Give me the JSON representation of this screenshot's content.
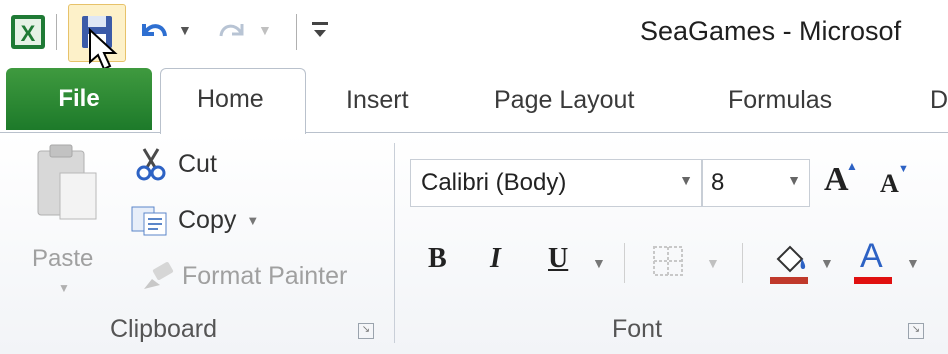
{
  "window": {
    "title": "SeaGames - Microsof"
  },
  "qat": {
    "app_icon": "excel-icon",
    "save_icon": "save-icon",
    "undo_icon": "undo-icon",
    "redo_icon": "redo-icon",
    "customize_icon": "customize-qat-icon"
  },
  "tabs": {
    "file": "File",
    "home": "Home",
    "insert": "Insert",
    "page_layout": "Page Layout",
    "formulas": "Formulas",
    "data": "D"
  },
  "clipboard": {
    "paste": "Paste",
    "cut": "Cut",
    "copy": "Copy",
    "format_painter": "Format Painter",
    "label": "Clipboard"
  },
  "font": {
    "font_name": "Calibri (Body)",
    "font_size": "8",
    "bold": "B",
    "italic": "I",
    "underline": "U",
    "grow": "A",
    "shrink": "A",
    "font_color": "A",
    "label": "Font"
  },
  "colors": {
    "file_tab": "#2b8a35",
    "fill_color_bar": "#c0392b",
    "font_color_bar": "#e01010"
  }
}
